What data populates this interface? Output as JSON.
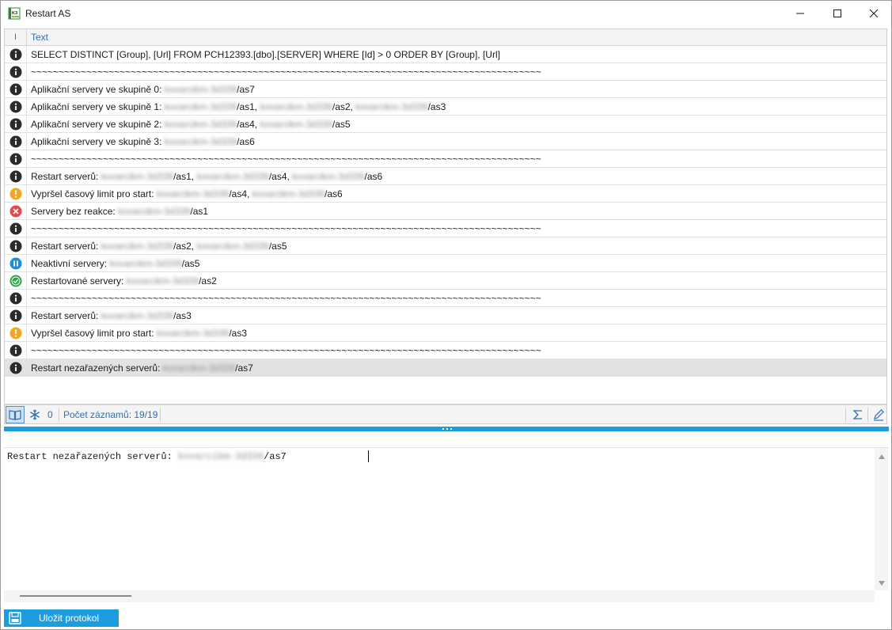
{
  "window": {
    "title": "Restart AS"
  },
  "grid": {
    "columns": {
      "icon": "I",
      "text": "Text"
    },
    "rows": [
      {
        "icon": "info",
        "parts": [
          {
            "t": "SELECT DISTINCT [Group], [Url] FROM PCH12393.[dbo].[SERVER] WHERE [Id] > 0 ORDER BY [Group], [Url]"
          }
        ]
      },
      {
        "icon": "info",
        "parts": [
          {
            "t": "~~~~~~~~~~~~~~~~~~~~~~~~~~~~~~~~~~~~~~~~~~~~~~~~~~~~~~~~~~~~~~~~~~~~~~~~~~~~~~~~~~~~~~~~~~~~"
          }
        ]
      },
      {
        "icon": "info",
        "parts": [
          {
            "t": "Aplikační servery ve skupině 0: "
          },
          {
            "t": "kovarcikm-3d339",
            "b": true
          },
          {
            "t": "/as7"
          }
        ]
      },
      {
        "icon": "info",
        "parts": [
          {
            "t": "Aplikační servery ve skupině 1: "
          },
          {
            "t": "kovarcikm-3d339",
            "b": true
          },
          {
            "t": "/as1, "
          },
          {
            "t": "kovarcikm-3d339",
            "b": true
          },
          {
            "t": "/as2, "
          },
          {
            "t": "kovarcikm-3d339",
            "b": true
          },
          {
            "t": "/as3"
          }
        ]
      },
      {
        "icon": "info",
        "parts": [
          {
            "t": "Aplikační servery ve skupině 2: "
          },
          {
            "t": "kovarcikm-3d339",
            "b": true
          },
          {
            "t": "/as4, "
          },
          {
            "t": "kovarcikm-3d339",
            "b": true
          },
          {
            "t": "/as5"
          }
        ]
      },
      {
        "icon": "info",
        "parts": [
          {
            "t": "Aplikační servery ve skupině 3: "
          },
          {
            "t": "kovarcikm-3d339",
            "b": true
          },
          {
            "t": "/as6"
          }
        ]
      },
      {
        "icon": "info",
        "parts": [
          {
            "t": "~~~~~~~~~~~~~~~~~~~~~~~~~~~~~~~~~~~~~~~~~~~~~~~~~~~~~~~~~~~~~~~~~~~~~~~~~~~~~~~~~~~~~~~~~~~~"
          }
        ]
      },
      {
        "icon": "info",
        "parts": [
          {
            "t": "Restart serverů: "
          },
          {
            "t": "kovarcikm-3d339",
            "b": true
          },
          {
            "t": "/as1, "
          },
          {
            "t": "kovarcikm-3d339",
            "b": true
          },
          {
            "t": "/as4, "
          },
          {
            "t": "kovarcikm-3d339",
            "b": true
          },
          {
            "t": "/as6"
          }
        ]
      },
      {
        "icon": "warning",
        "parts": [
          {
            "t": "Vypršel časový limit pro start: "
          },
          {
            "t": "kovarcikm-3d339",
            "b": true
          },
          {
            "t": "/as4, "
          },
          {
            "t": "kovarcikm-3d339",
            "b": true
          },
          {
            "t": "/as6"
          }
        ]
      },
      {
        "icon": "error",
        "parts": [
          {
            "t": "Servery bez reakce: "
          },
          {
            "t": "kovarcikm-3d339",
            "b": true
          },
          {
            "t": "/as1"
          }
        ]
      },
      {
        "icon": "info",
        "parts": [
          {
            "t": "~~~~~~~~~~~~~~~~~~~~~~~~~~~~~~~~~~~~~~~~~~~~~~~~~~~~~~~~~~~~~~~~~~~~~~~~~~~~~~~~~~~~~~~~~~~~"
          }
        ]
      },
      {
        "icon": "info",
        "parts": [
          {
            "t": "Restart serverů: "
          },
          {
            "t": "kovarcikm-3d339",
            "b": true
          },
          {
            "t": "/as2, "
          },
          {
            "t": "kovarcikm-3d339",
            "b": true
          },
          {
            "t": "/as5"
          }
        ]
      },
      {
        "icon": "paused",
        "parts": [
          {
            "t": "Neaktivní servery: "
          },
          {
            "t": "kovarcikm-3d339",
            "b": true
          },
          {
            "t": "/as5"
          }
        ]
      },
      {
        "icon": "success",
        "parts": [
          {
            "t": "Restartované servery: "
          },
          {
            "t": "kovarcikm-3d339",
            "b": true
          },
          {
            "t": "/as2"
          }
        ]
      },
      {
        "icon": "info",
        "parts": [
          {
            "t": "~~~~~~~~~~~~~~~~~~~~~~~~~~~~~~~~~~~~~~~~~~~~~~~~~~~~~~~~~~~~~~~~~~~~~~~~~~~~~~~~~~~~~~~~~~~~"
          }
        ]
      },
      {
        "icon": "info",
        "parts": [
          {
            "t": "Restart serverů: "
          },
          {
            "t": "kovarcikm-3d339",
            "b": true
          },
          {
            "t": "/as3"
          }
        ]
      },
      {
        "icon": "warning",
        "parts": [
          {
            "t": "Vypršel časový limit pro start: "
          },
          {
            "t": "kovarcikm-3d339",
            "b": true
          },
          {
            "t": "/as3"
          }
        ]
      },
      {
        "icon": "info",
        "parts": [
          {
            "t": "~~~~~~~~~~~~~~~~~~~~~~~~~~~~~~~~~~~~~~~~~~~~~~~~~~~~~~~~~~~~~~~~~~~~~~~~~~~~~~~~~~~~~~~~~~~~"
          }
        ]
      },
      {
        "icon": "info",
        "selected": true,
        "parts": [
          {
            "t": "Restart nezařazených serverů: "
          },
          {
            "t": "kovarcikm-3d339",
            "b": true
          },
          {
            "t": "/as7"
          }
        ]
      }
    ]
  },
  "status": {
    "book_icon": "book-icon",
    "snowflake_icon": "snowflake-icon",
    "filter_count": "0",
    "records": "Počet záznamů: 19/19"
  },
  "detail": {
    "prefix": "Restart nezařazených serverů: ",
    "host": "kovarcikm-3d339",
    "suffix": "/as7"
  },
  "footer": {
    "save_label": "Uložit protokol"
  },
  "colors": {
    "accent": "#1c9de0",
    "info": "#2b2b2b",
    "warning": "#f5a623",
    "error": "#e5484d",
    "success": "#28a745",
    "paused": "#1c8fd8"
  }
}
